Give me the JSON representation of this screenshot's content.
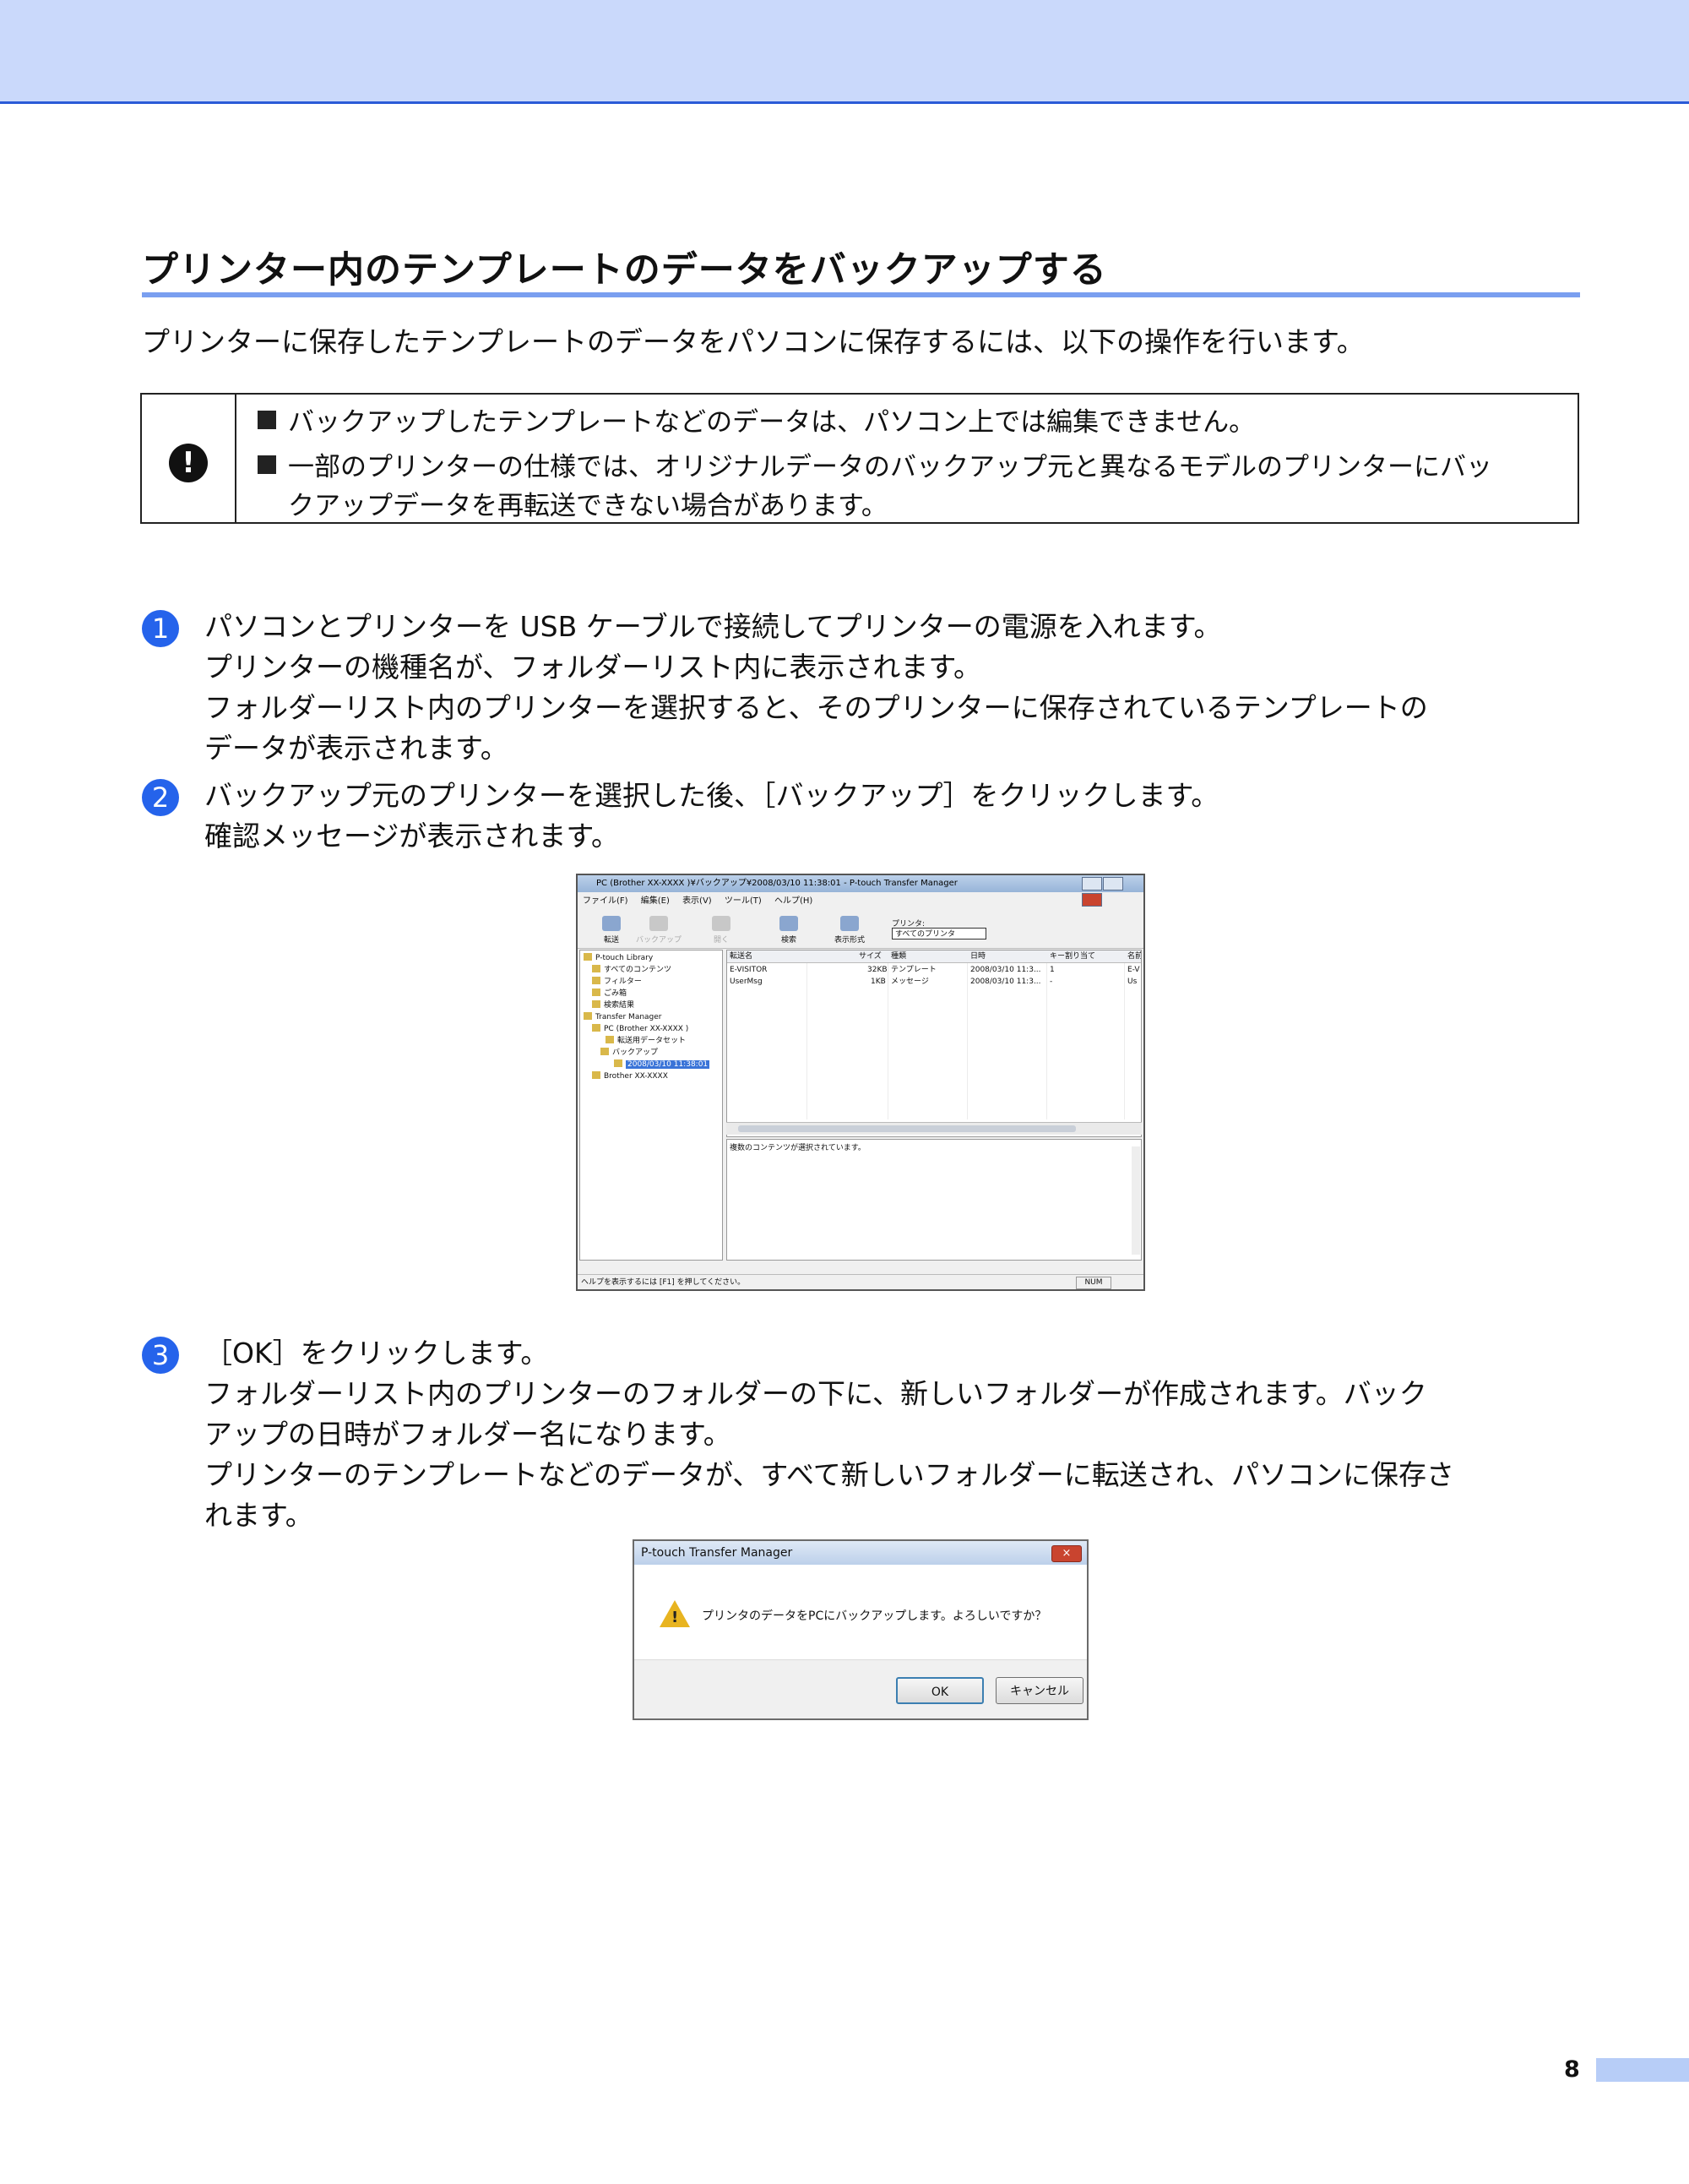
{
  "heading": "プリンター内のテンプレートのデータをバックアップする",
  "intro": "プリンターに保存したテンプレートのデータをパソコンに保存するには、以下の操作を行います。",
  "note": {
    "icon": "!",
    "item1": "バックアップしたテンプレートなどのデータは、パソコン上では編集できません。",
    "item2a": "一部のプリンターの仕様では、オリジナルデータのバックアップ元と異なるモデルのプリンターにバッ",
    "item2b": "クアップデータを再転送できない場合があります。"
  },
  "steps": [
    {
      "num": "1",
      "lines": [
        "パソコンとプリンターを USB ケーブルで接続してプリンターの電源を入れます。",
        "プリンターの機種名が、フォルダーリスト内に表示されます。",
        "フォルダーリスト内のプリンターを選択すると、そのプリンターに保存されているテンプレートの",
        "データが表示されます。"
      ]
    },
    {
      "num": "2",
      "lines": [
        "バックアップ元のプリンターを選択した後、［バックアップ］をクリックします。",
        "確認メッセージが表示されます。"
      ]
    },
    {
      "num": "3",
      "lines": [
        "［OK］をクリックします。",
        "フォルダーリスト内のプリンターのフォルダーの下に、新しいフォルダーが作成されます。バック",
        "アップの日時がフォルダー名になります。",
        "プリンターのテンプレートなどのデータが、すべて新しいフォルダーに転送され、パソコンに保存さ",
        "れます。"
      ]
    }
  ],
  "screenshot1": {
    "title": "PC (Brother XX-XXXX )¥バックアップ¥2008/03/10 11:38:01 - P-touch Transfer Manager",
    "menu": [
      "ファイル(F)",
      "編集(E)",
      "表示(V)",
      "ツール(T)",
      "ヘルプ(H)"
    ],
    "toolbar": [
      "転送",
      "バックアップ",
      "開く",
      "検索",
      "表示形式"
    ],
    "printer_label": "プリンタ:",
    "printer_select": "すべてのプリンタ",
    "tree": [
      "P-touch Library",
      "すべてのコンテンツ",
      "フィルター",
      "ごみ箱",
      "検索結果",
      "Transfer Manager",
      "PC (Brother XX-XXXX )",
      "転送用データセット",
      "バックアップ",
      "2008/03/10 11:38:01",
      "Brother XX-XXXX"
    ],
    "columns": [
      "転送名",
      "サイズ",
      "種類",
      "日時",
      "キー割り当て",
      "名前"
    ],
    "rows": [
      [
        "E-VISITOR",
        "32KB",
        "テンプレート",
        "2008/03/10 11:3...",
        "1",
        "E-V"
      ],
      [
        "UserMsg",
        "1KB",
        "メッセージ",
        "2008/03/10 11:3...",
        "-",
        "Us"
      ]
    ],
    "message": "複数のコンテンツが選択されています。",
    "status": "ヘルプを表示するには [F1] を押してください。",
    "num": "NUM"
  },
  "dialog": {
    "title": "P-touch Transfer Manager",
    "close": "×",
    "message": "プリンタのデータをPCにバックアップします。よろしいですか？",
    "ok": "OK",
    "cancel": "キャンセル"
  },
  "page_number": "8"
}
